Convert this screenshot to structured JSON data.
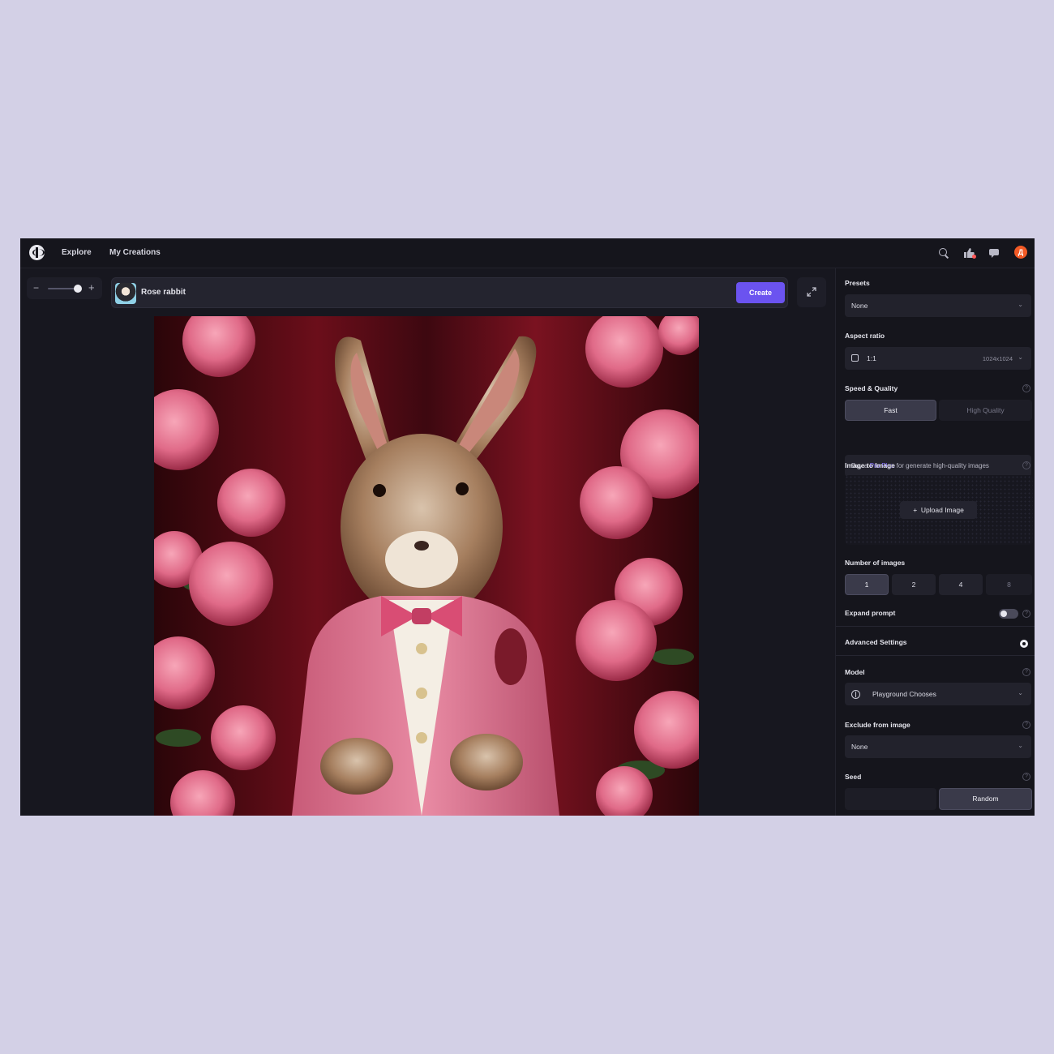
{
  "nav": {
    "explore": "Explore",
    "my_creations": "My Creations",
    "avatar_initial": "Д"
  },
  "prompt": {
    "text": "Rose rabbit",
    "create_label": "Create"
  },
  "zoom": {
    "minus": "−",
    "plus": "+",
    "level": 0.8
  },
  "panel": {
    "presets": {
      "label": "Presets",
      "value": "None"
    },
    "aspect_ratio": {
      "label": "Aspect ratio",
      "value": "1:1",
      "resolution": "1024x1024"
    },
    "speed_quality": {
      "label": "Speed & Quality",
      "options": [
        "Fast",
        "High Quality"
      ],
      "selected": "Fast",
      "note_prefix": "Buy a ",
      "note_link": "Pro Plan",
      "note_suffix": " for generate high-quality images"
    },
    "image_to_image": {
      "label": "Image to Image",
      "upload_label": "Upload Image"
    },
    "number_of_images": {
      "label": "Number of images",
      "options": [
        "1",
        "2",
        "4",
        "8"
      ],
      "selected": "1"
    },
    "expand_prompt": {
      "label": "Expand prompt",
      "enabled": false
    },
    "advanced_settings": {
      "label": "Advanced Settings"
    },
    "model": {
      "label": "Model",
      "value": "Playground Chooses"
    },
    "exclude": {
      "label": "Exclude from image",
      "value": "None"
    },
    "seed": {
      "label": "Seed",
      "random_label": "Random"
    },
    "help_glyph": "?"
  },
  "colors": {
    "accent": "#6b53f0",
    "link": "#8571ff",
    "avatar": "#f25a26",
    "page_background": "#d3d0e6",
    "app_background": "#17171f"
  },
  "icons": [
    "logo-icon",
    "search-icon",
    "thumbs-up-icon",
    "chat-icon",
    "expand-icon",
    "chevron-down-icon",
    "plus-icon",
    "gear-icon",
    "model-icon",
    "help-icon"
  ]
}
